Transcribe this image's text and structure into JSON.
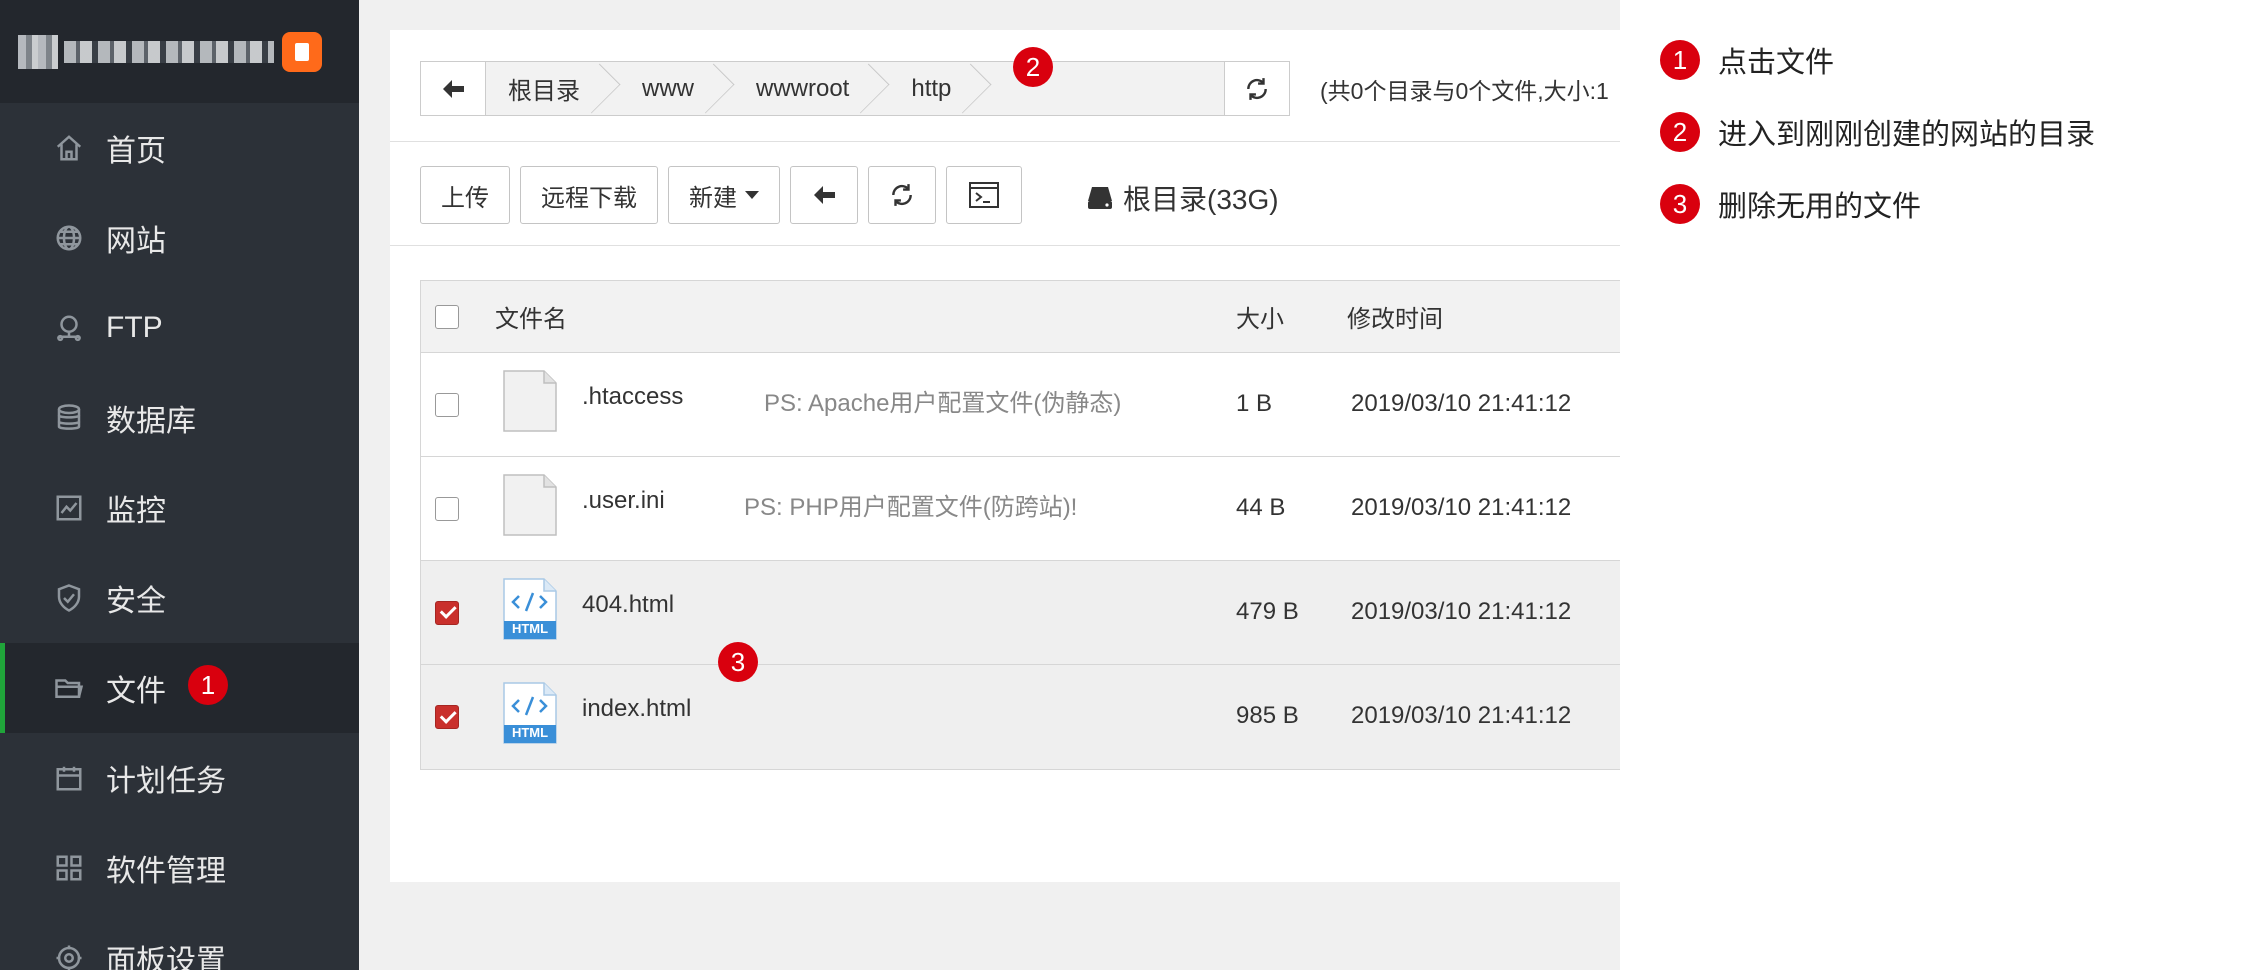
{
  "sidebar": {
    "items": [
      {
        "label": "首页",
        "icon": "home-icon"
      },
      {
        "label": "网站",
        "icon": "globe-icon"
      },
      {
        "label": "FTP",
        "icon": "ftp-icon"
      },
      {
        "label": "数据库",
        "icon": "database-icon"
      },
      {
        "label": "监控",
        "icon": "monitor-icon"
      },
      {
        "label": "安全",
        "icon": "shield-icon"
      },
      {
        "label": "文件",
        "icon": "folder-icon",
        "active": true
      },
      {
        "label": "计划任务",
        "icon": "calendar-icon"
      },
      {
        "label": "软件管理",
        "icon": "grid-icon"
      },
      {
        "label": "面板设置",
        "icon": "gear-icon"
      }
    ],
    "active_accent": "#20a53a"
  },
  "path": {
    "crumbs": [
      "根目录",
      "www",
      "wwwroot",
      "http"
    ],
    "summary": "(共0个目录与0个文件,大小:1"
  },
  "toolbar": {
    "upload": "上传",
    "remote_download": "远程下载",
    "new": "新建",
    "disk": "根目录(33G)"
  },
  "table": {
    "headers": {
      "name": "文件名",
      "size": "大小",
      "time": "修改时间"
    },
    "rows": [
      {
        "name": ".htaccess",
        "note": "PS: Apache用户配置文件(伪静态)",
        "size": "1 B",
        "time": "2019/03/10 21:41:12",
        "checked": false,
        "type": "blank"
      },
      {
        "name": ".user.ini",
        "note": "PS: PHP用户配置文件(防跨站)!",
        "size": "44 B",
        "time": "2019/03/10 21:41:12",
        "checked": false,
        "type": "blank"
      },
      {
        "name": "404.html",
        "note": "",
        "size": "479 B",
        "time": "2019/03/10 21:41:12",
        "checked": true,
        "type": "html"
      },
      {
        "name": "index.html",
        "note": "",
        "size": "985 B",
        "time": "2019/03/10 21:41:12",
        "checked": true,
        "type": "html"
      }
    ],
    "html_icon_label": "HTML"
  },
  "markers": {
    "one": "1",
    "two": "2",
    "three": "3"
  },
  "legend": {
    "items": [
      {
        "num": "1",
        "text": "点击文件"
      },
      {
        "num": "2",
        "text": "进入到刚刚创建的网站的目录"
      },
      {
        "num": "3",
        "text": "删除无用的文件"
      }
    ]
  },
  "colors": {
    "marker": "#d9000e",
    "checkbox_checked": "#c9302c",
    "sidebar_bg": "#2c3138"
  }
}
